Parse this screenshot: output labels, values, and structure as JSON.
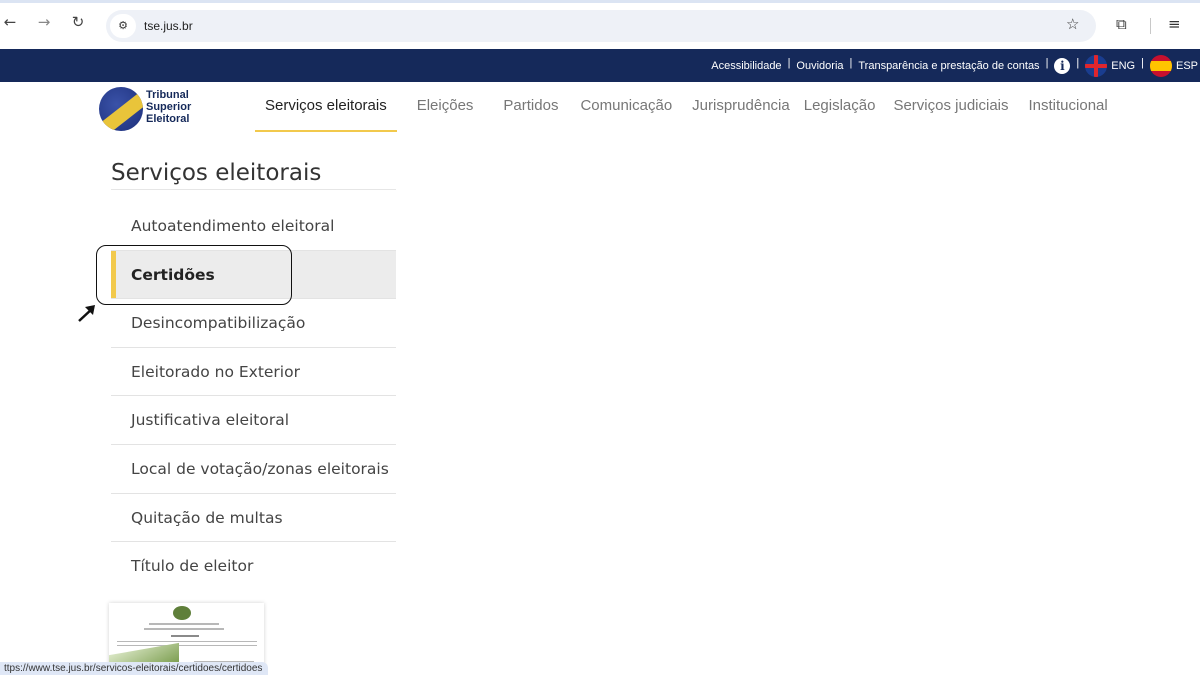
{
  "browser": {
    "url": "tse.jus.br",
    "status_url": "ttps://www.tse.jus.br/servicos-eleitorais/certidoes/certidoes"
  },
  "topbar": {
    "links": [
      "Acessibilidade",
      "Ouvidoria",
      "Transparência e prestação de contas"
    ],
    "lang_en": "ENG",
    "lang_es": "ESP"
  },
  "logo": {
    "line1": "Tribunal",
    "line2": "Superior",
    "line3": "Eleitoral"
  },
  "mainnav": {
    "items": [
      "Serviços eleitorais",
      "Eleições",
      "Partidos",
      "Comunicação",
      "Jurisprudência",
      "Legislação",
      "Serviços judiciais",
      "Institucional"
    ],
    "active_index": 0
  },
  "sidebar": {
    "title": "Serviços eleitorais",
    "items": [
      "Autoatendimento eleitoral",
      "Certidões",
      "Desincompatibilização",
      "Eleitorado no Exterior",
      "Justificativa eleitoral",
      "Local de votação/zonas eleitorais",
      "Quitação de multas",
      "Título de eleitor"
    ],
    "active_index": 1
  },
  "colors": {
    "topbar_bg": "#15295a",
    "accent_yellow": "#f2c94c",
    "active_item_bg": "#ececec"
  },
  "icons": {
    "back": "arrow-left-icon",
    "forward": "arrow-right-icon",
    "reload": "reload-icon",
    "site_info": "tune-icon",
    "bookmark": "star-icon",
    "extensions": "puzzle-icon",
    "reading_list": "list-icon",
    "info": "info-icon"
  }
}
